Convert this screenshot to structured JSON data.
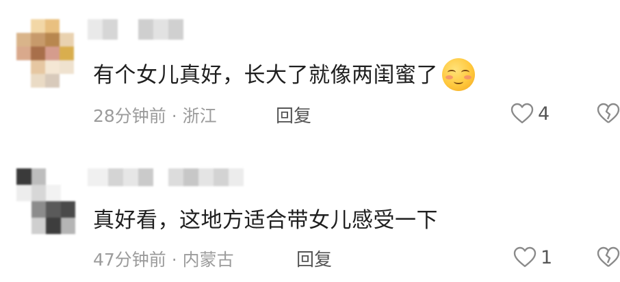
{
  "comments": [
    {
      "text": "有个女儿真好，长大了就像两闺蜜了",
      "time": "28分钟前",
      "location": "浙江",
      "reply_label": "回复",
      "like_count": "4",
      "emoji": "smiling-face-with-blush-emoji"
    },
    {
      "text": "真好看，这地方适合带女儿感受一下",
      "time": "47分钟前",
      "location": "内蒙古",
      "reply_label": "回复",
      "like_count": "1"
    }
  ],
  "separator": " · ",
  "colors": {
    "text": "#1f1f1f",
    "meta": "#9b9b9b",
    "icon": "#8a8a8a"
  }
}
